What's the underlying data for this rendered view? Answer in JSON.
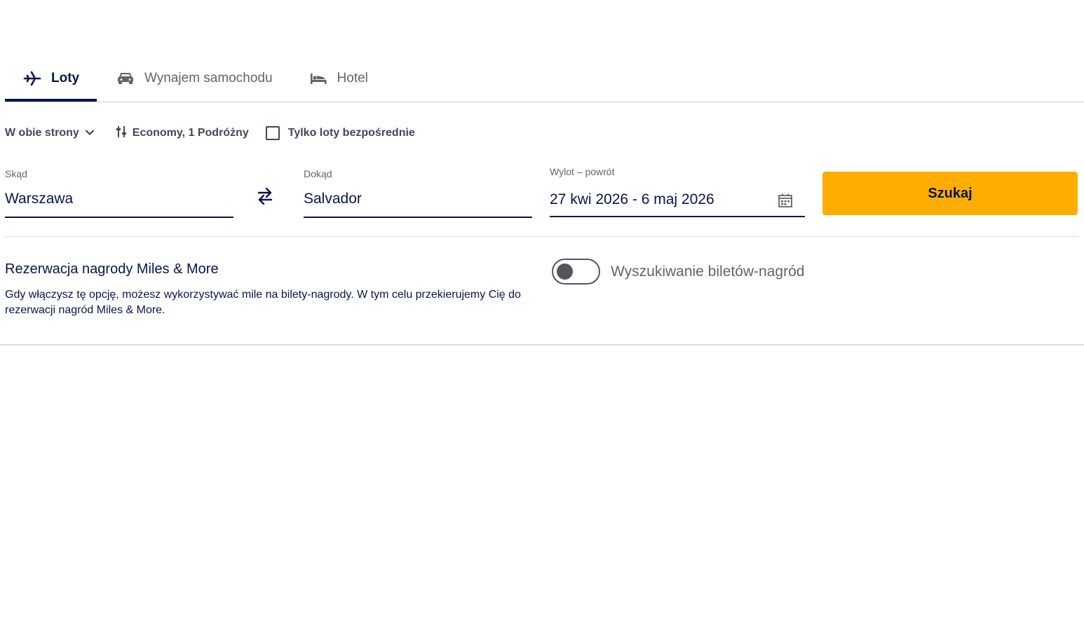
{
  "tabs": [
    {
      "label": "Loty",
      "icon": "airplane-icon",
      "active": true
    },
    {
      "label": "Wynajem samochodu",
      "icon": "car-icon",
      "active": false
    },
    {
      "label": "Hotel",
      "icon": "bed-icon",
      "active": false
    }
  ],
  "options": {
    "trip_type": "W obie strony",
    "cabin_passengers": "Economy, 1 Podróżny",
    "direct_only_label": "Tylko loty bezpośrednie",
    "direct_only_checked": false
  },
  "search": {
    "from_label": "Skąd",
    "from_value": "Warszawa",
    "to_label": "Dokąd",
    "to_value": "Salvador",
    "dates_label": "Wylot – powrót",
    "dates_value": "27 kwi 2026 - 6 maj 2026",
    "submit_label": "Szukaj"
  },
  "miles": {
    "title": "Rezerwacja nagrody Miles & More",
    "description": "Gdy włączysz tę opcję, możesz wykorzystywać mile na bilety-nagrody. W tym celu przekierujemy Cię do rezerwacji nagród Miles & More.",
    "toggle_label": "Wyszukiwanie biletów-nagród",
    "toggle_on": false
  },
  "colors": {
    "brand_navy": "#05164d",
    "accent_yellow": "#ffad00",
    "muted_text": "#63636e"
  }
}
